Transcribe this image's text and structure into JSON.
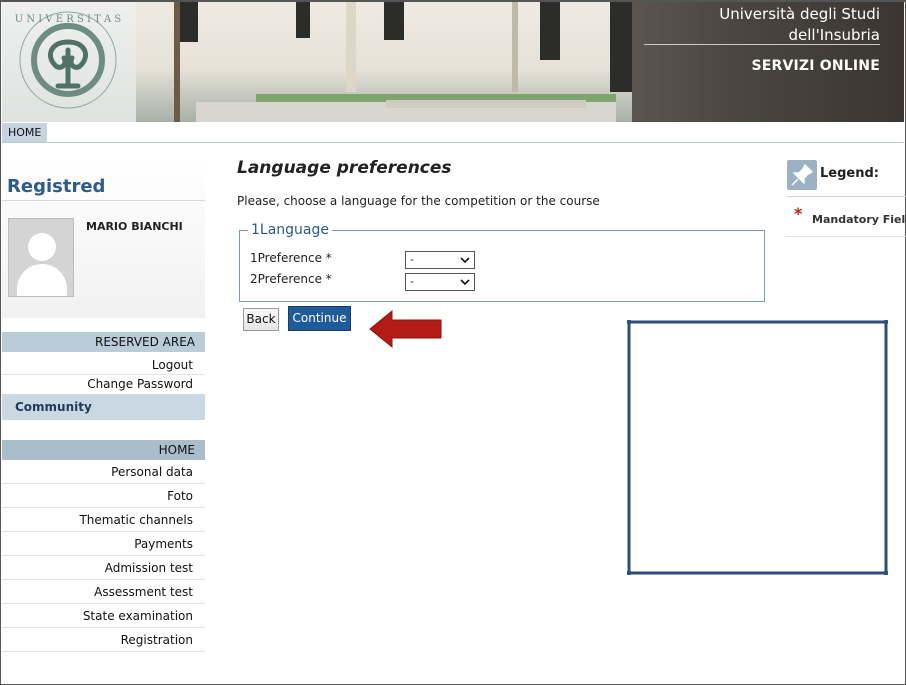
{
  "header": {
    "university_name": "Università degli Studi dell'Insubria",
    "services_label": "SERVIZI ONLINE",
    "seal_text": "UNIVERSITAS STUDIORUM INSUBRIAE"
  },
  "breadcrumb": {
    "home": "HOME"
  },
  "sidebar": {
    "section_title": "Registred",
    "user_name": "MARIO BIANCHI",
    "reserved_area": {
      "heading": "RESERVED AREA",
      "items": [
        "Logout",
        "Change Password"
      ]
    },
    "community_label": "Community",
    "home_menu": {
      "heading": "HOME",
      "items": [
        "Personal data",
        "Foto",
        "Thematic channels",
        "Payments",
        "Admission test",
        "Assessment test",
        "State examination",
        "Registration"
      ]
    }
  },
  "main": {
    "title": "Language preferences",
    "instructions": "Please, choose a language for the competition or the course",
    "fieldset_legend": "1Language",
    "preferences": [
      {
        "label": "1Preference *",
        "value": "-"
      },
      {
        "label": "2Preference *",
        "value": "-"
      }
    ],
    "back_button": "Back",
    "continue_button": "Continue"
  },
  "legend": {
    "title": "Legend:",
    "mandatory_marker": "*",
    "mandatory_label": "Mandatory Field"
  },
  "colors": {
    "accent_blue": "#1f5b9b",
    "annotation_red": "#c0221b",
    "annotation_box": "#2b4e7e"
  }
}
